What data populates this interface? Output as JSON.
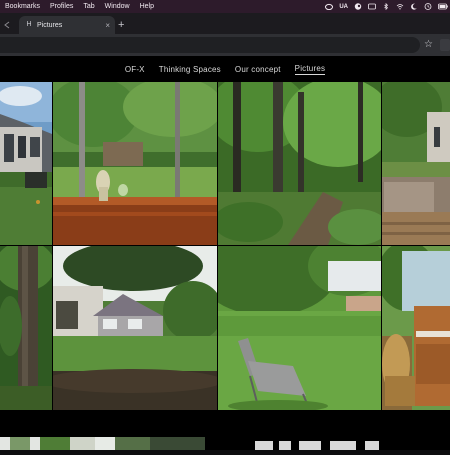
{
  "menubar": {
    "items": [
      "Bookmarks",
      "Profiles",
      "Tab",
      "Window",
      "Help"
    ],
    "status": {
      "language": "UA"
    },
    "icons": [
      "creative-cloud-icon",
      "language-icon",
      "steam-icon",
      "bluetooth-icon",
      "wifi-icon",
      "moon-icon",
      "clock-icon",
      "battery-icon"
    ]
  },
  "browser": {
    "tab": {
      "title": "Pictures",
      "favicon": "H"
    },
    "new_tab": "+",
    "close": "×",
    "bookmark": "☆"
  },
  "site": {
    "nav": [
      "OF-X",
      "Thinking Spaces",
      "Our concept",
      "Pictures"
    ],
    "active": "Pictures"
  },
  "gallery": {
    "rows": 2,
    "tiles": [
      {
        "subject": "house-on-lawn"
      },
      {
        "subject": "window-view-garden"
      },
      {
        "subject": "forest-path"
      },
      {
        "subject": "terrace-deck"
      },
      {
        "subject": "tree-trunk"
      },
      {
        "subject": "backyard-house"
      },
      {
        "subject": "lawn-with-chair"
      },
      {
        "subject": "piano-room"
      }
    ]
  },
  "colors": {
    "menubar": "#2d1b2b",
    "tabstrip": "#1c1b1f",
    "toolbar": "#2f3034",
    "page": "#000000",
    "nav_text": "#d9d9d9"
  }
}
